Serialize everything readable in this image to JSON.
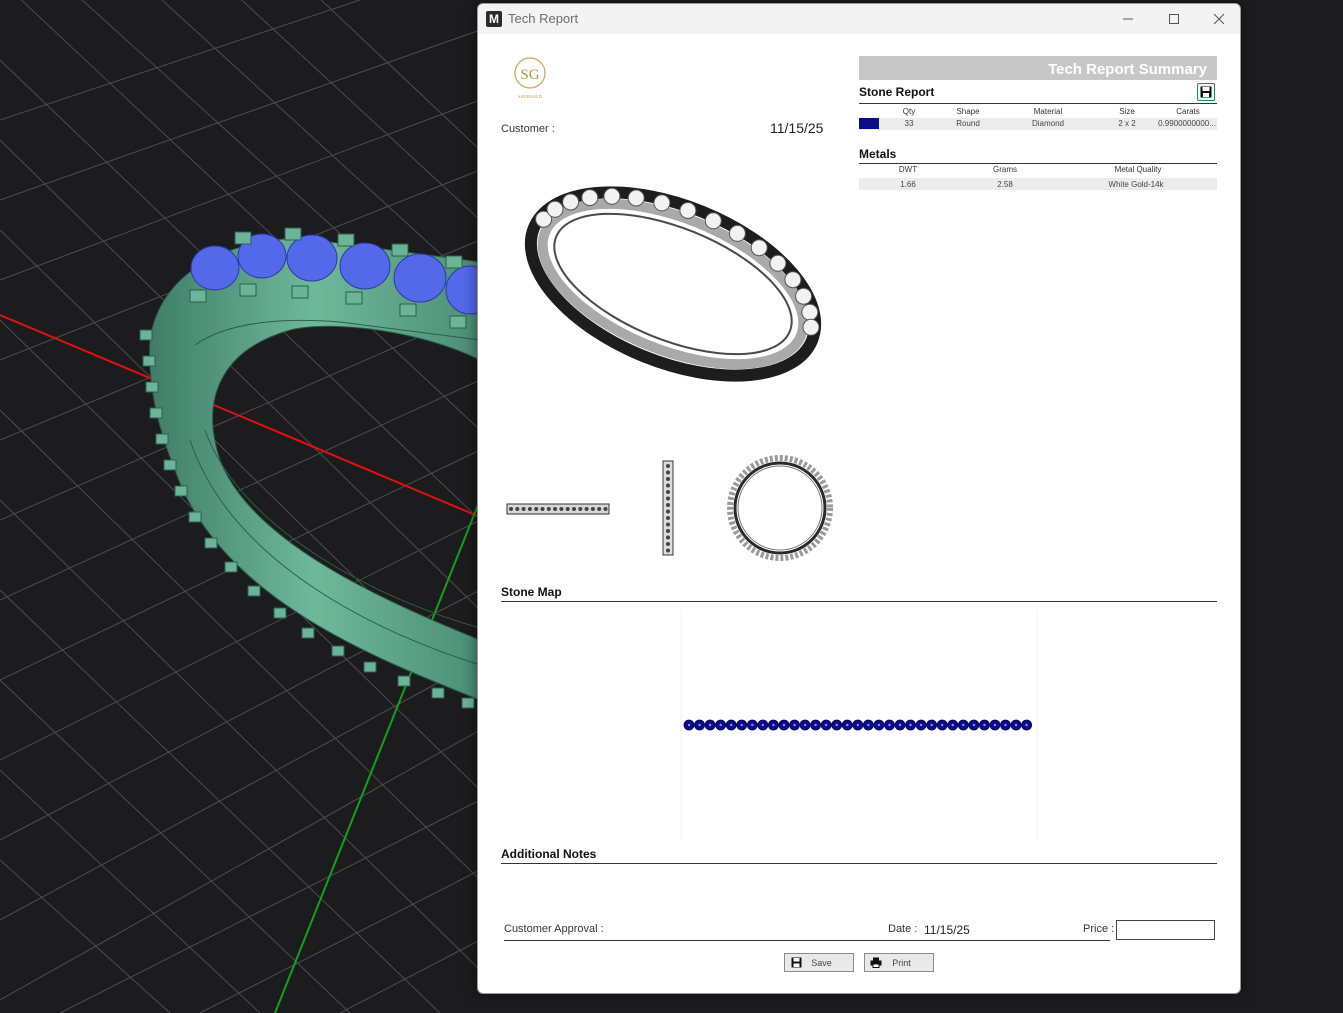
{
  "window": {
    "title": "Tech Report"
  },
  "logo": {
    "brand_text": "SAYEGOLD",
    "initials": "SG"
  },
  "header": {
    "customer_label": "Customer :",
    "date": "11/15/25"
  },
  "summary": {
    "banner": "Tech Report Summary"
  },
  "stone_report": {
    "title": "Stone Report",
    "columns": [
      "Qty",
      "Shape",
      "Material",
      "Size",
      "Carats"
    ],
    "rows": [
      {
        "swatch_color": "#0b0b8c",
        "qty": "33",
        "shape": "Round",
        "material": "Diamond",
        "size": "2 x 2",
        "carats": "0.9900000000..."
      }
    ]
  },
  "metals": {
    "title": "Metals",
    "columns": [
      "DWT",
      "Grams",
      "Metal Quality"
    ],
    "rows": [
      {
        "dwt": "1.66",
        "grams": "2.58",
        "quality": "White Gold-14k"
      }
    ]
  },
  "stone_map": {
    "title": "Stone Map",
    "stone_count": 33,
    "stone_color": "#0b0b8c"
  },
  "notes": {
    "title": "Additional Notes"
  },
  "footer": {
    "approval_label": "Customer Approval :",
    "date_label": "Date :",
    "date_value": "11/15/25",
    "price_label": "Price :",
    "price_value": ""
  },
  "buttons": {
    "save": "Save",
    "print": "Print"
  },
  "colors": {
    "ring_mesh": "#5aa58a",
    "stones": "#4a5fe0",
    "axis_x": "#e01010",
    "axis_y": "#17a017",
    "grid": "#505055"
  }
}
